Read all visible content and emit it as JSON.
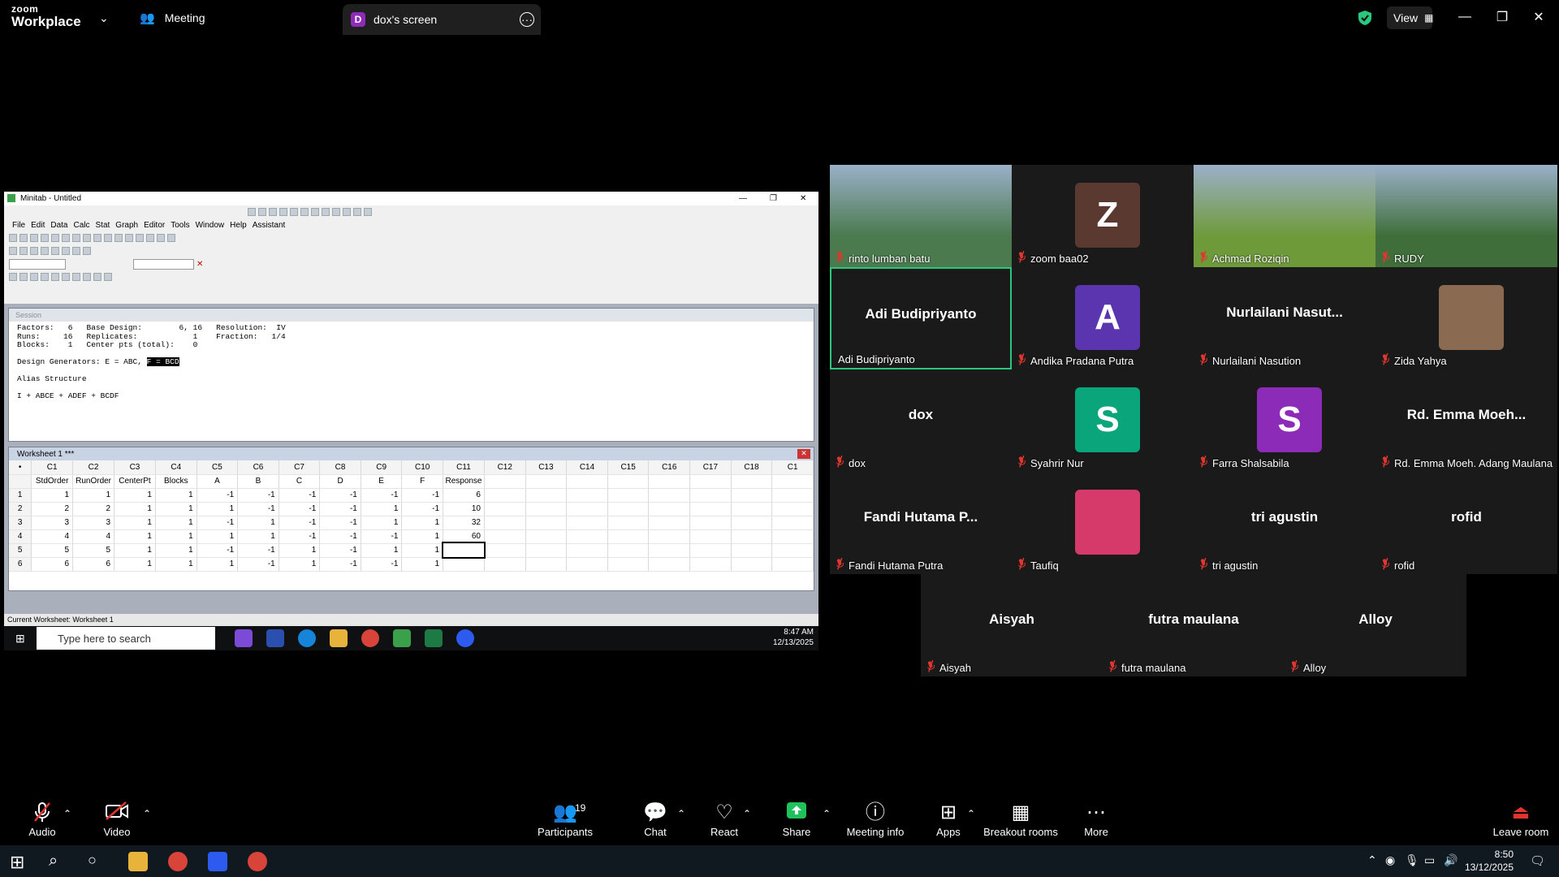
{
  "zoom": {
    "logo_line1": "zoom",
    "logo_line2": "Workplace",
    "meeting_label": "Meeting",
    "screen_tab_initial": "D",
    "screen_tab_label": "dox's screen",
    "view_label": "View"
  },
  "minitab": {
    "title": "Minitab - Untitled",
    "menu": [
      "File",
      "Edit",
      "Data",
      "Calc",
      "Stat",
      "Graph",
      "Editor",
      "Tools",
      "Window",
      "Help",
      "Assistant"
    ],
    "session_title": "Session",
    "session_lines": [
      "Factors:   6   Base Design:        6, 16   Resolution:  IV",
      "Runs:     16   Replicates:            1    Fraction:   1/4",
      "Blocks:    1   Center pts (total):    0",
      "",
      "Design Generators: E = ABC, "
    ],
    "session_highlight": "F = BCD",
    "session_lines2": [
      "",
      "Alias Structure",
      "",
      "I + ABCE + ADEF + BCDF"
    ],
    "worksheet_title": "Worksheet 1 ***",
    "col_headers": [
      "C1",
      "C2",
      "C3",
      "C4",
      "C5",
      "C6",
      "C7",
      "C8",
      "C9",
      "C10",
      "C11",
      "C12",
      "C13",
      "C14",
      "C15",
      "C16",
      "C17",
      "C18",
      "C1"
    ],
    "col_names": [
      "StdOrder",
      "RunOrder",
      "CenterPt",
      "Blocks",
      "A",
      "B",
      "C",
      "D",
      "E",
      "F",
      "Response"
    ],
    "rows": [
      [
        "1",
        "1",
        "1",
        "1",
        "1",
        "-1",
        "-1",
        "-1",
        "-1",
        "-1",
        "-1",
        "6"
      ],
      [
        "2",
        "2",
        "2",
        "1",
        "1",
        "1",
        "-1",
        "-1",
        "-1",
        "1",
        "-1",
        "10"
      ],
      [
        "3",
        "3",
        "3",
        "1",
        "1",
        "-1",
        "1",
        "-1",
        "-1",
        "1",
        "1",
        "32"
      ],
      [
        "4",
        "4",
        "4",
        "1",
        "1",
        "1",
        "1",
        "-1",
        "-1",
        "-1",
        "1",
        "60"
      ],
      [
        "5",
        "5",
        "5",
        "1",
        "1",
        "-1",
        "-1",
        "1",
        "-1",
        "1",
        "1",
        ""
      ],
      [
        "6",
        "6",
        "6",
        "1",
        "1",
        "1",
        "-1",
        "1",
        "-1",
        "-1",
        "1",
        ""
      ]
    ],
    "status": "Current Worksheet: Worksheet 1",
    "taskbar_search": "Type here to search",
    "taskbar_time": "8:47 AM",
    "taskbar_date": "12/13/2025"
  },
  "participants_tiles": [
    {
      "name": "rinto lumban batu",
      "type": "photo",
      "color": "#4a7a4e"
    },
    {
      "name": "zoom baa02",
      "type": "avatar",
      "letter": "Z",
      "color": "#5a3a30"
    },
    {
      "name": "Achmad Roziqin",
      "type": "photo",
      "color": "#6f9a3a"
    },
    {
      "name": "RUDY",
      "type": "photo",
      "color": "#3f6e3a"
    },
    {
      "name": "Adi Budipriyanto",
      "type": "text",
      "big": "Adi Budipriyanto"
    },
    {
      "name": "Andika Pradana Putra",
      "type": "avatar",
      "letter": "A",
      "color": "#5b35b0"
    },
    {
      "name": "Nurlailani Nasution",
      "type": "text",
      "big": "Nurlailani  Nasut..."
    },
    {
      "name": "Zida Yahya",
      "type": "photo-small",
      "color": "#8a6a50"
    },
    {
      "name": "dox",
      "type": "text",
      "big": "dox"
    },
    {
      "name": "Syahrir Nur",
      "type": "avatar",
      "letter": "S",
      "color": "#0aa57a"
    },
    {
      "name": "Farra Shalsabila",
      "type": "avatar",
      "letter": "S",
      "color": "#8c2bb8"
    },
    {
      "name": "Rd. Emma Moeh. Adang Maulana",
      "type": "text",
      "big": "Rd. Emma Moeh..."
    },
    {
      "name": "Fandi Hutama Putra",
      "type": "text",
      "big": "Fandi Hutama P..."
    },
    {
      "name": "Taufiq",
      "type": "photo-small",
      "color": "#d63a6a"
    },
    {
      "name": "tri agustin",
      "type": "text",
      "big": "tri agustin"
    },
    {
      "name": "rofid",
      "type": "text",
      "big": "rofid"
    },
    {
      "name": "Aisyah",
      "type": "text",
      "big": "Aisyah"
    },
    {
      "name": "futra maulana",
      "type": "text",
      "big": "futra maulana"
    },
    {
      "name": "Alloy",
      "type": "text",
      "big": "Alloy"
    }
  ],
  "controls": {
    "audio": "Audio",
    "video": "Video",
    "participants": "Participants",
    "participants_count": "19",
    "chat": "Chat",
    "react": "React",
    "share": "Share",
    "meeting_info": "Meeting info",
    "apps": "Apps",
    "breakout": "Breakout rooms",
    "more": "More",
    "leave": "Leave room"
  },
  "os": {
    "time": "8:50",
    "date": "13/12/2025"
  },
  "colors": {
    "active_speaker": "#2ac77e",
    "muted": "#e0362f",
    "share_green": "#1fc15a"
  }
}
